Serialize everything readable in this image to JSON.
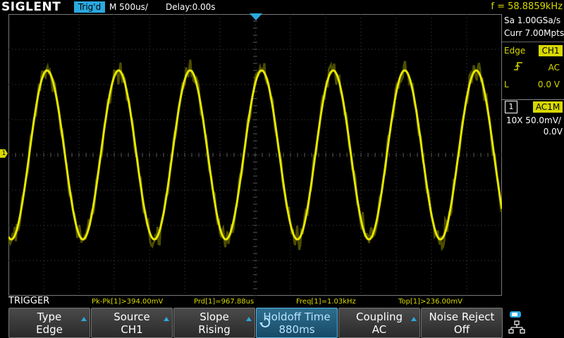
{
  "header": {
    "brand": "SIGLENT",
    "trigger_status": "Trig'd",
    "timebase": "M 500us/",
    "delay": "Delay:0.00s",
    "frequency": "f = 58.8859kHz"
  },
  "acquisition": {
    "sample_rate": "Sa 1.00GSa/s",
    "memory": "Curr 7.00Mpts"
  },
  "trigger_panel": {
    "type_label": "Edge",
    "source_badge": "CH1",
    "coupling": "AC",
    "level_label": "L",
    "level_value": "0.0 V"
  },
  "channel_panel": {
    "number": "1",
    "coupling_badge": "AC1M",
    "probe_scale": "10X  50.0mV/",
    "offset": "0.0V"
  },
  "channel_marker": "1",
  "menu_title": "TRIGGER",
  "measurements": [
    "Pk-Pk[1]>394.00mV",
    "Prd[1]=967.88us",
    "Freq[1]=1.03kHz",
    "Top[1]>236.00mV"
  ],
  "softkeys": [
    {
      "title": "Type",
      "value": "Edge"
    },
    {
      "title": "Source",
      "value": "CH1"
    },
    {
      "title": "Slope",
      "value": "Rising"
    },
    {
      "title": "Holdoff Time",
      "value": "880ms"
    },
    {
      "title": "Coupling",
      "value": "AC"
    },
    {
      "title": "Noise Reject",
      "value": "Off"
    }
  ],
  "waveform": {
    "color": "#e6e600",
    "cycles": 6.9,
    "amplitude_divisions": 2.7
  },
  "colors": {
    "accent": "#2aa9e0",
    "channel1": "#d8d800",
    "background": "#000000",
    "grid": "#555555"
  },
  "icons": [
    "rising-edge-icon",
    "knob-icon",
    "usb-icon",
    "network-icon"
  ]
}
